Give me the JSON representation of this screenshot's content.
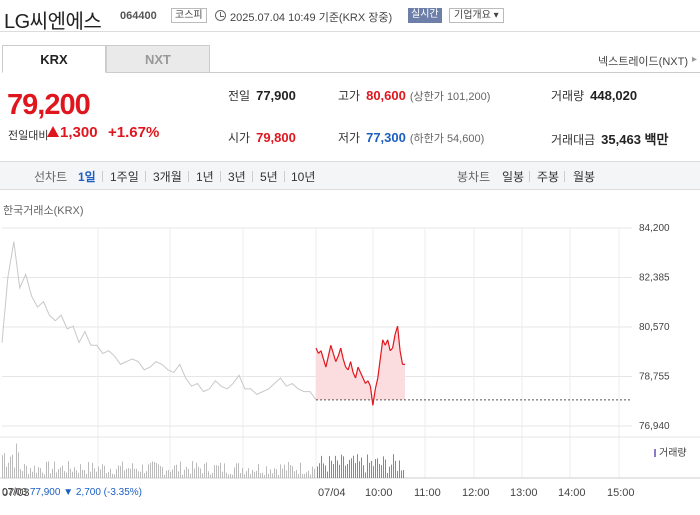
{
  "header": {
    "title": "LG씨엔에스",
    "code": "064400",
    "market_tag": "코스피",
    "datetime": "2025.07.04 10:49 기준(KRX 장중)",
    "realtime_tag": "실시간",
    "overview_label": "기업개요 ▾"
  },
  "tabs": [
    {
      "label": "KRX",
      "active": true
    },
    {
      "label": "NXT",
      "active": false
    }
  ],
  "nxt_link": "넥스트레이드(NXT)",
  "price": {
    "current": "79,200",
    "prev_label": "전일대비",
    "change": "1,300",
    "rate": "+1.67%"
  },
  "stats": {
    "prev_close": {
      "label": "전일",
      "value": "77,900"
    },
    "high": {
      "label": "고가",
      "value": "80,600",
      "sub": "(상한가 101,200)"
    },
    "volume": {
      "label": "거래량",
      "value": "448,020"
    },
    "open": {
      "label": "시가",
      "value": "79,800"
    },
    "low": {
      "label": "저가",
      "value": "77,300",
      "sub": "(하한가 54,600)"
    },
    "amount": {
      "label": "거래대금",
      "value": "35,463 백만"
    }
  },
  "period_bar": {
    "line_label": "선차트",
    "line_periods": [
      "1일",
      "1주일",
      "3개월",
      "1년",
      "3년",
      "5년",
      "10년"
    ],
    "active_period": "1일",
    "candle_label": "봉차트",
    "candle_periods": [
      "일봉",
      "주봉",
      "월봉"
    ]
  },
  "exchange_label": "한국거래소(KRX)",
  "volume_legend": "거래량",
  "footer": {
    "date": "07/03",
    "close": "77,900",
    "change": "▼ 2,700",
    "rate": "(-3.35%)"
  },
  "colors": {
    "up": "#e0161e",
    "down": "#1b5fc2",
    "prev_day_line": "#c8c8c8",
    "volume_bar": "#8c7ac8"
  },
  "chart_data": {
    "type": "line",
    "ylim": [
      76940,
      84200
    ],
    "y_ticks": [
      "84,200",
      "82,385",
      "80,570",
      "78,755",
      "76,940"
    ],
    "x_ticks": [
      "07/03",
      "07/04",
      "10:00",
      "11:00",
      "12:00",
      "13:00",
      "14:00",
      "15:00"
    ],
    "grid": true,
    "series": [
      {
        "date": "07/03",
        "values": [
          80000,
          82400,
          83700,
          82000,
          82500,
          81700,
          81300,
          81500,
          81000,
          80800,
          81000,
          80500,
          80600,
          80000,
          80400,
          79900,
          79900,
          79600,
          79700,
          79500,
          79200,
          79300,
          79400,
          79300,
          79000,
          79100,
          79300,
          79200,
          79000,
          78900,
          79200,
          78700,
          78400,
          78500,
          78200,
          78300,
          78600,
          78400,
          78300,
          78500,
          78800,
          78300,
          78300,
          78100,
          78200,
          78300,
          78500,
          78700,
          78400,
          78500,
          78300,
          78200,
          78200,
          77900
        ]
      },
      {
        "date": "07/04",
        "values": [
          79800,
          79600,
          79700,
          79400,
          79100,
          79500,
          79900,
          79600,
          79300,
          79500,
          79800,
          79400,
          79100,
          79000,
          79300,
          78900,
          78700,
          79100,
          78900,
          78700,
          78500,
          78600,
          78400,
          77700,
          78300,
          78700,
          79400,
          80100,
          79900,
          80100,
          79700,
          79800,
          80300,
          80600,
          79700,
          79200,
          79200
        ]
      }
    ],
    "prev_close_line": 77900
  }
}
